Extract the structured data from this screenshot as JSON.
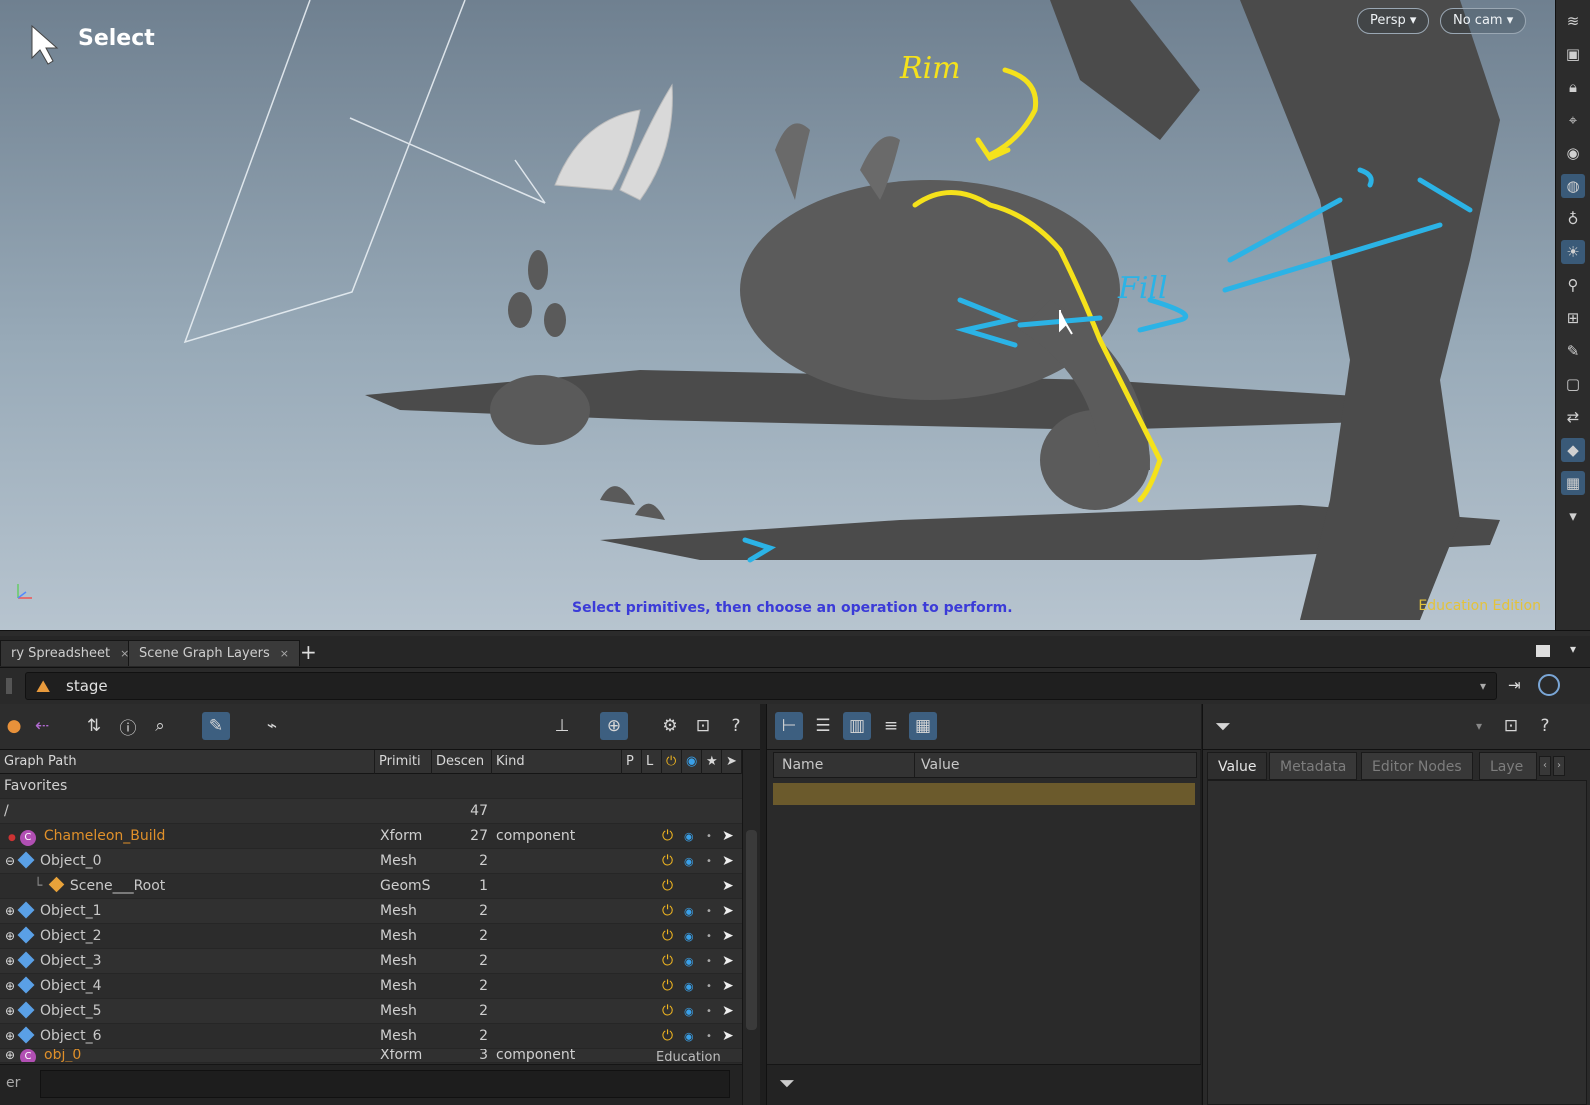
{
  "viewport": {
    "tool_label": "Select",
    "camera_persp": "Persp ▾",
    "camera_nocam": "No cam ▾",
    "status_message": "Select primitives, then choose an operation to perform.",
    "watermark": "Education Edition",
    "annotation_rim": "Rim",
    "annotation_fill": "Fill",
    "annotation_color_rim": "#f5e21b",
    "annotation_color_fill": "#2bb3e6"
  },
  "tabs": [
    {
      "label": "ry Spreadsheet",
      "close": "×"
    },
    {
      "label": "Scene Graph Layers",
      "close": "×"
    }
  ],
  "add_tab": "+",
  "path_field": {
    "value": "stage"
  },
  "scene_tree": {
    "columns": [
      "Graph Path",
      "Primiti",
      "Descen",
      "Kind",
      "P",
      "L"
    ],
    "favorites_label": "Favorites",
    "root_label": "/",
    "root_count": "47",
    "rows": [
      {
        "name": "Chameleon_Build",
        "prim": "Xform",
        "desc": "27",
        "kind": "component",
        "badge": "C",
        "highlight": "#e0902a"
      },
      {
        "name": "Object_0",
        "prim": "Mesh",
        "desc": "2",
        "kind": ""
      },
      {
        "name": "Scene___Root",
        "prim": "GeomS",
        "desc": "1",
        "kind": ""
      },
      {
        "name": "Object_1",
        "prim": "Mesh",
        "desc": "2",
        "kind": ""
      },
      {
        "name": "Object_2",
        "prim": "Mesh",
        "desc": "2",
        "kind": ""
      },
      {
        "name": "Object_3",
        "prim": "Mesh",
        "desc": "2",
        "kind": ""
      },
      {
        "name": "Object_4",
        "prim": "Mesh",
        "desc": "2",
        "kind": ""
      },
      {
        "name": "Object_5",
        "prim": "Mesh",
        "desc": "2",
        "kind": ""
      },
      {
        "name": "Object_6",
        "prim": "Mesh",
        "desc": "2",
        "kind": ""
      },
      {
        "name": "obj_0",
        "prim": "Xform",
        "desc": "3",
        "kind": "component"
      }
    ],
    "watermark": "Education",
    "filter_label": "er"
  },
  "attributes": {
    "columns": [
      "Name",
      "Value"
    ]
  },
  "detail_tabs": [
    "Value",
    "Metadata",
    "Editor Nodes",
    "Laye"
  ]
}
